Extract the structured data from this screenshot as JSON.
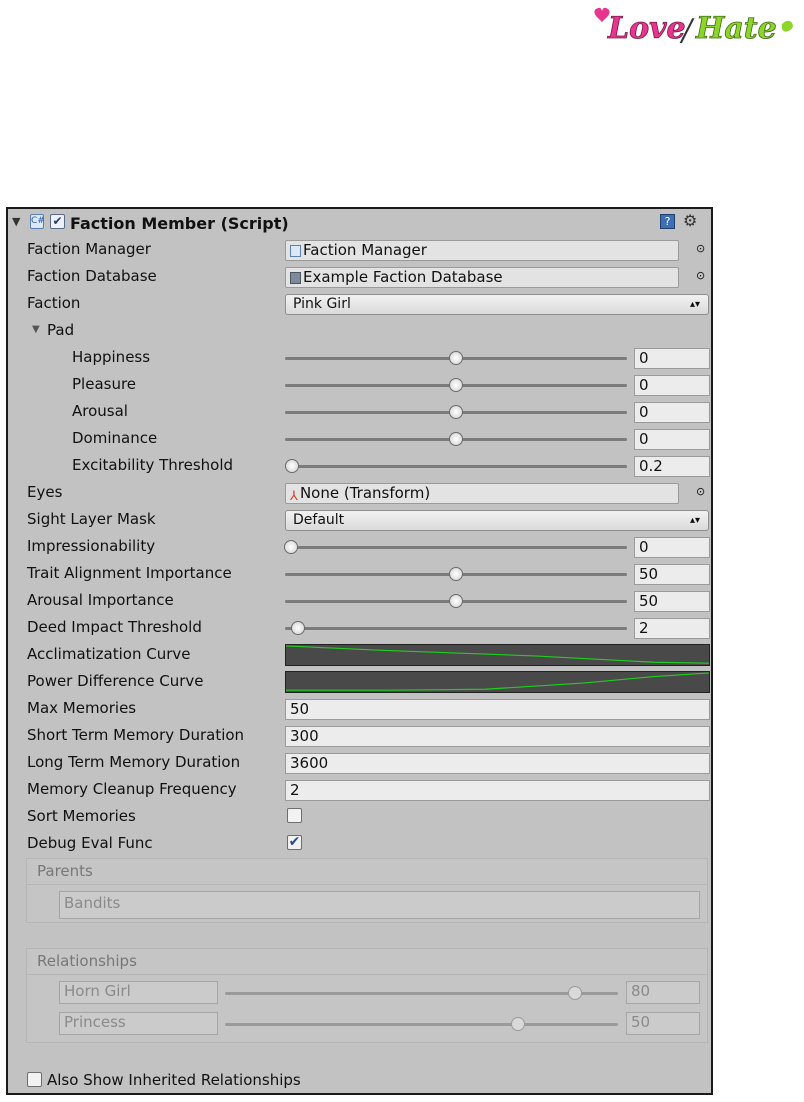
{
  "logo": {
    "text": "Love/Hate"
  },
  "component": {
    "title": "Faction Member (Script)",
    "enabled": true
  },
  "fields": {
    "faction_manager": {
      "label": "Faction Manager",
      "value": "Faction Manager"
    },
    "faction_database": {
      "label": "Faction Database",
      "value": "Example Faction Database"
    },
    "faction": {
      "label": "Faction",
      "value": "Pink Girl"
    },
    "pad": {
      "label": "Pad"
    },
    "happiness": {
      "label": "Happiness",
      "value": "0"
    },
    "pleasure": {
      "label": "Pleasure",
      "value": "0"
    },
    "arousal": {
      "label": "Arousal",
      "value": "0"
    },
    "dominance": {
      "label": "Dominance",
      "value": "0"
    },
    "excitability": {
      "label": "Excitability Threshold",
      "value": "0.2"
    },
    "eyes": {
      "label": "Eyes",
      "value": "None (Transform)"
    },
    "sight_layer_mask": {
      "label": "Sight Layer Mask",
      "value": "Default"
    },
    "impressionability": {
      "label": "Impressionability",
      "value": "0"
    },
    "trait_alignment": {
      "label": "Trait Alignment Importance",
      "value": "50"
    },
    "arousal_importance": {
      "label": "Arousal Importance",
      "value": "50"
    },
    "deed_impact": {
      "label": "Deed Impact Threshold",
      "value": "2"
    },
    "acclimatization_curve": {
      "label": "Acclimatization Curve"
    },
    "power_difference_curve": {
      "label": "Power Difference Curve"
    },
    "max_memories": {
      "label": "Max Memories",
      "value": "50"
    },
    "short_term": {
      "label": "Short Term Memory Duration",
      "value": "300"
    },
    "long_term": {
      "label": "Long Term Memory Duration",
      "value": "3600"
    },
    "cleanup": {
      "label": "Memory Cleanup Frequency",
      "value": "2"
    },
    "sort_memories": {
      "label": "Sort Memories",
      "checked": false
    },
    "debug_eval": {
      "label": "Debug Eval Func",
      "checked": true
    }
  },
  "parents": {
    "title": "Parents",
    "items": [
      "Bandits"
    ]
  },
  "relationships": {
    "title": "Relationships",
    "items": [
      {
        "name": "Horn Girl",
        "value": "80"
      },
      {
        "name": "Princess",
        "value": "50"
      }
    ]
  },
  "also_show": {
    "label": "Also Show Inherited Relationships",
    "checked": false
  },
  "colors": {
    "panel": "#c2c2c2",
    "curve_line": "#22cc22",
    "curve_bg": "#494949",
    "logo_pink": "#e8368f",
    "logo_green": "#8cd62c"
  }
}
